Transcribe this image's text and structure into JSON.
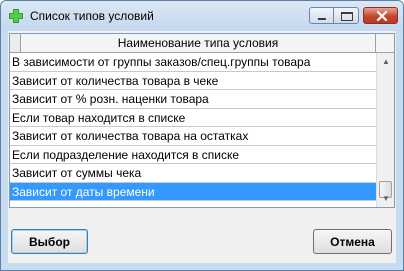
{
  "window": {
    "title": "Список типов условий",
    "icon": "green-cross-icon",
    "accent": "#3399ff"
  },
  "grid": {
    "column_header": "Наименование типа условия",
    "rows": [
      "В зависимости от группы заказов/спец.группы товара",
      "Зависит от количества товара в чеке",
      "Зависит от % розн. наценки товара",
      "Если товар находится в списке",
      "Зависит от количества товара на остатках",
      "Если подразделение находится в списке",
      "Зависит от суммы чека",
      "Зависит от даты времени"
    ],
    "selected_index": 7
  },
  "buttons": {
    "select_label": "Выбор",
    "cancel_label": "Отмена"
  }
}
